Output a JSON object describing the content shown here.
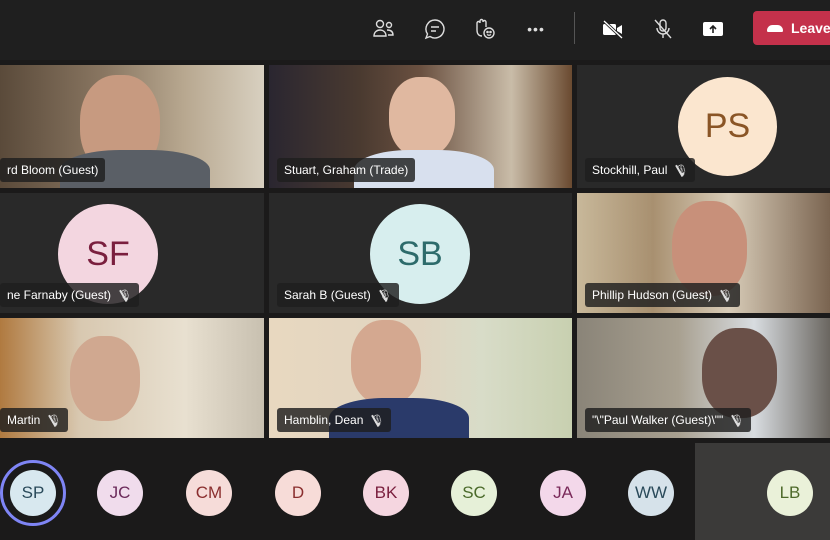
{
  "toolbar": {
    "participants_icon": "people-icon",
    "chat_icon": "chat-icon",
    "reactions_icon": "raise-hand-icon",
    "more_icon": "more-icon",
    "camera_icon": "camera-off-icon",
    "mic_icon": "mic-off-icon",
    "share_icon": "share-icon",
    "more": "•••",
    "leave_label": "Leave",
    "leave_color": "#c4314b"
  },
  "tiles": [
    {
      "name": "rd Bloom (Guest)",
      "type": "video"
    },
    {
      "name": "Stuart, Graham (Trade)",
      "type": "video"
    },
    {
      "name": "Stockhill, Paul",
      "type": "avatar",
      "initials": "PS",
      "muted": true
    },
    {
      "name": "ne Farnaby (Guest)",
      "type": "avatar",
      "initials": "SF",
      "muted": true
    },
    {
      "name": "Sarah B (Guest)",
      "type": "avatar",
      "initials": "SB",
      "muted": true
    },
    {
      "name": "Phillip Hudson (Guest)",
      "type": "video",
      "muted": true
    },
    {
      "name": "Martin",
      "type": "video",
      "muted": true
    },
    {
      "name": "Hamblin, Dean",
      "type": "video",
      "muted": true
    },
    {
      "name": "\"\\\"Paul Walker (Guest)\\\"\"",
      "type": "video",
      "muted": true
    }
  ],
  "strip": [
    "SP",
    "JC",
    "CM",
    "D",
    "BK",
    "SC",
    "JA",
    "WW",
    "LB"
  ]
}
